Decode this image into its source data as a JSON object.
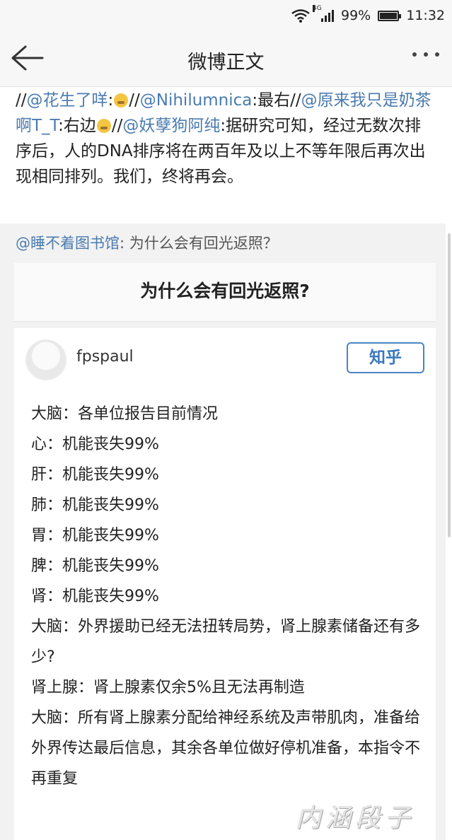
{
  "status_bar": {
    "network_type": "4G",
    "battery_percent": "99%",
    "battery_level": 0.99,
    "time": "11:32"
  },
  "nav": {
    "title": "微博正文"
  },
  "post": {
    "segments": [
      {
        "text": "//",
        "type": "text"
      },
      {
        "text": "@花生了咩",
        "type": "mention"
      },
      {
        "text": ":",
        "type": "text"
      },
      {
        "type": "emoji",
        "icon": "crying-emoji-icon"
      },
      {
        "text": "//",
        "type": "text"
      },
      {
        "text": "@Nihilumnica",
        "type": "mention"
      },
      {
        "text": ":最右//",
        "type": "text"
      },
      {
        "text": "@原来我只是奶茶啊T_T",
        "type": "mention"
      },
      {
        "text": ":右边",
        "type": "text"
      },
      {
        "type": "emoji",
        "icon": "crying-emoji-icon"
      },
      {
        "text": "//",
        "type": "text"
      },
      {
        "text": "@妖孽狗阿纯",
        "type": "mention"
      },
      {
        "text": ":据研究可知，经过无数次排序后，人的DNA排序将在两百年及以上不等年限后再次出现相同排列。我们，终将再会。",
        "type": "text"
      }
    ]
  },
  "retweet": {
    "source_user": "@睡不着图书馆",
    "source_text": ": 为什么会有回光返照？",
    "question_title": "为什么会有回光返照?",
    "author": "fpspaul",
    "platform_button": "知乎",
    "answer_lines": [
      "大脑：各单位报告目前情况",
      "心：机能丧失99%",
      "肝：机能丧失99%",
      "肺：机能丧失99%",
      "胃：机能丧失99%",
      "脾：机能丧失99%",
      "肾：机能丧失99%",
      "大脑：外界援助已经无法扭转局势，肾上腺素储备还有多少?",
      "肾上腺：肾上腺素仅余5%且无法再制造",
      "大脑：所有肾上腺素分配给神经系统及声带肌肉，准备给外界传达最后信息，其余各单位做好停机准备，本指令不再重复"
    ],
    "watermark": "内涵段子"
  }
}
